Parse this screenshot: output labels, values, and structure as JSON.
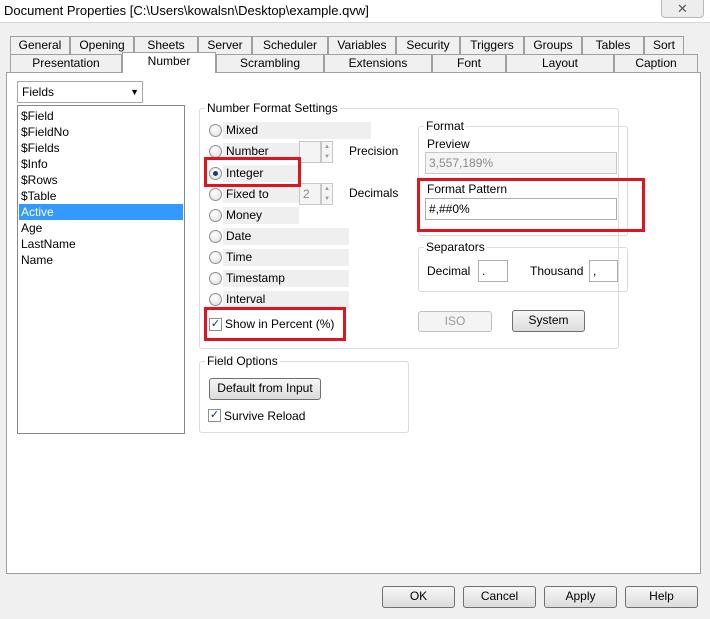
{
  "window": {
    "title": "Document Properties [C:\\Users\\kowalsn\\Desktop\\example.qvw]",
    "close_glyph": "✕"
  },
  "tabs_row1": [
    "General",
    "Opening",
    "Sheets",
    "Server",
    "Scheduler",
    "Variables",
    "Security",
    "Triggers",
    "Groups",
    "Tables",
    "Sort"
  ],
  "tabs_row2": [
    "Presentation",
    "Number",
    "Scrambling",
    "Extensions",
    "Font",
    "Layout",
    "Caption"
  ],
  "active_tab": "Number",
  "fields_dropdown": {
    "value": "Fields"
  },
  "field_list": [
    "$Field",
    "$FieldNo",
    "$Fields",
    "$Info",
    "$Rows",
    "$Table",
    "Active",
    "Age",
    "LastName",
    "Name"
  ],
  "selected_field": "Active",
  "number_format": {
    "group_label": "Number Format Settings",
    "options": [
      "Mixed",
      "Number",
      "Integer",
      "Fixed to",
      "Money",
      "Date",
      "Time",
      "Timestamp",
      "Interval"
    ],
    "selected": "Integer",
    "precision_label": "Precision",
    "precision_value": "",
    "decimals_label": "Decimals",
    "decimals_value": "2",
    "show_percent_label": "Show in Percent (%)",
    "show_percent_checked": true
  },
  "format": {
    "group_label": "Format",
    "preview_label": "Preview",
    "preview_value": "3,557,189%",
    "pattern_label": "Format Pattern",
    "pattern_value": "#,##0%"
  },
  "separators": {
    "group_label": "Separators",
    "decimal_label": "Decimal",
    "decimal_value": ".",
    "thousand_label": "Thousand",
    "thousand_value": ","
  },
  "buttons": {
    "iso": "ISO",
    "system": "System",
    "default_from_input": "Default from Input"
  },
  "field_options": {
    "group_label": "Field Options",
    "survive_reload_label": "Survive Reload",
    "survive_reload_checked": true
  },
  "footer": {
    "ok": "OK",
    "cancel": "Cancel",
    "apply": "Apply",
    "help": "Help"
  },
  "colors": {
    "selection": "#3399ff",
    "highlight": "#e0141e"
  }
}
